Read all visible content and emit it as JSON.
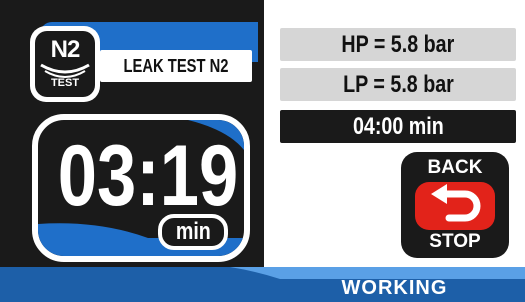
{
  "header": {
    "badge_symbol": "N2",
    "badge_caption": "TEST",
    "title": "LEAK TEST N2"
  },
  "timer": {
    "value": "03:19",
    "unit": "min"
  },
  "parameters": {
    "hp": "HP = 5.8 bar",
    "lp": "LP = 5.8 bar",
    "duration": "04:00 min"
  },
  "back_stop": {
    "top_label": "BACK",
    "bottom_label": "STOP",
    "icon": "undo-arrow-icon"
  },
  "status": {
    "text": "WORKING"
  },
  "colors": {
    "panel": "#1a1a1a",
    "accent_blue": "#1f6fc9",
    "status_blue": "#1d5fa8",
    "stop_red": "#e2231a",
    "param_gray": "#d6d6d6"
  }
}
